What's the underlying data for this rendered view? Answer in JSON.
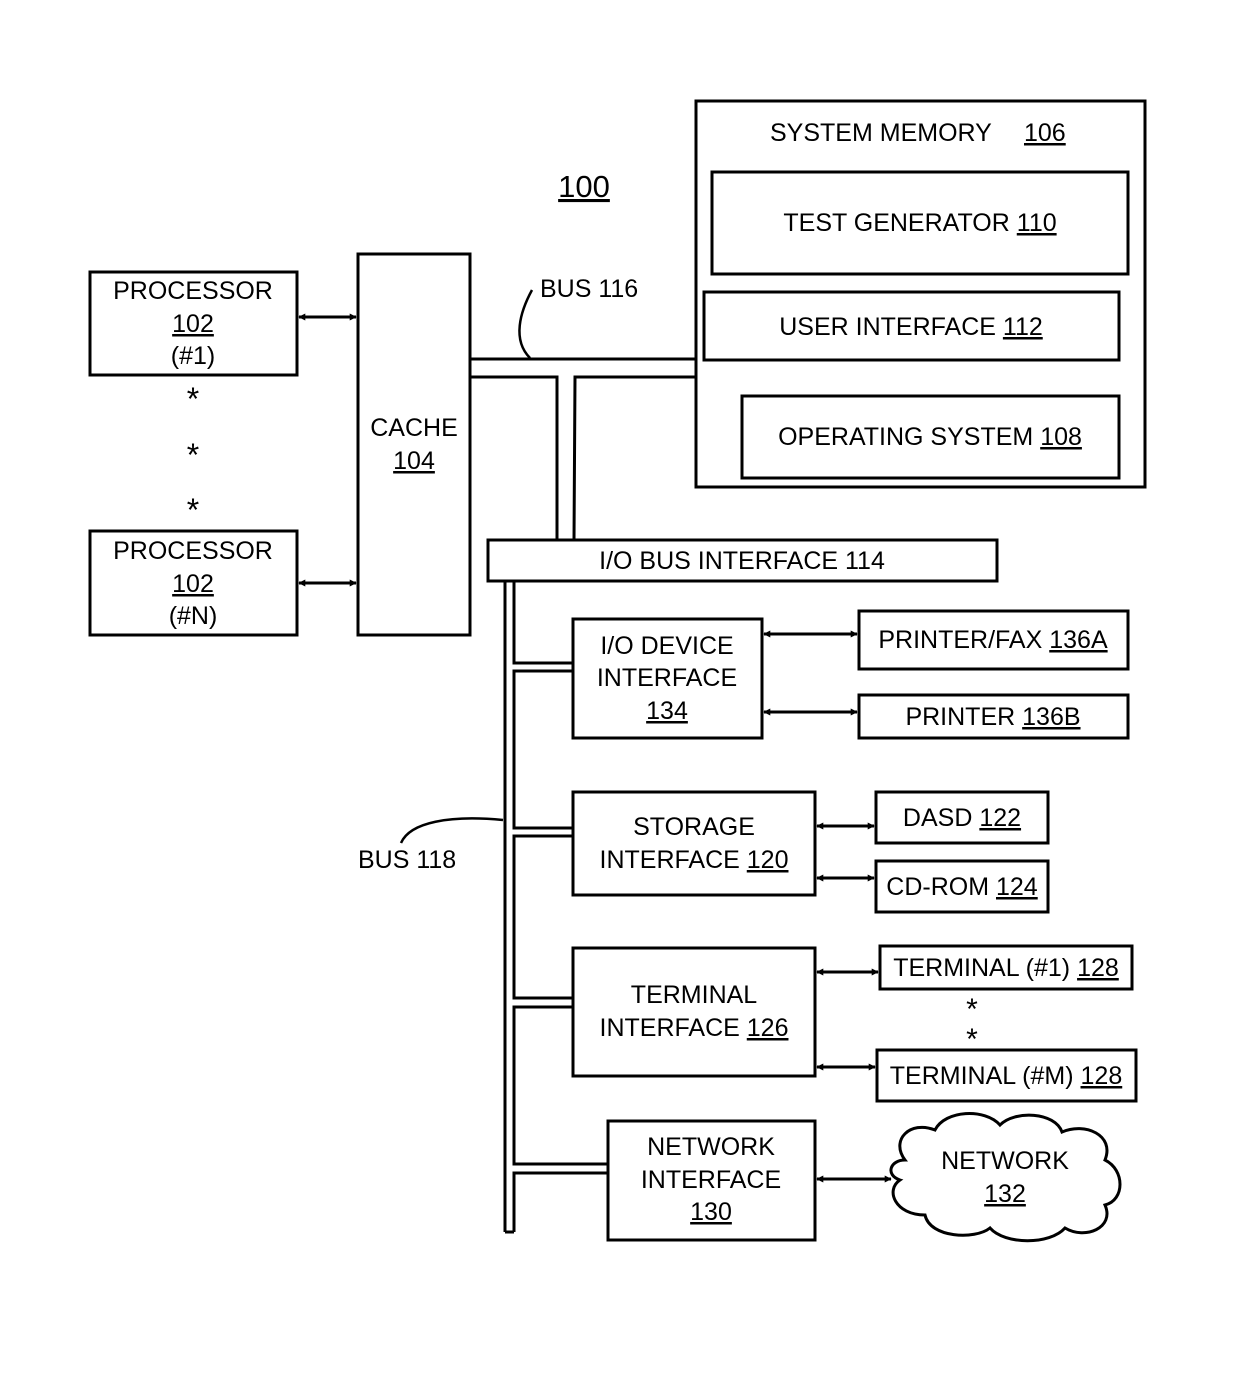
{
  "figure": {
    "ref": "100",
    "colors": {
      "stroke": "#000000",
      "background": "#ffffff"
    }
  },
  "nodes": {
    "processor1": {
      "name": "PROCESSOR",
      "ref": "102",
      "suffix": "(#1)"
    },
    "processorN": {
      "name": "PROCESSOR",
      "ref": "102",
      "suffix": "(#N)"
    },
    "processor_ellipsis": "*",
    "cache": {
      "name": "CACHE",
      "ref": "104"
    },
    "system_memory": {
      "name": "SYSTEM MEMORY",
      "ref": "106"
    },
    "test_generator": {
      "name": "TEST GENERATOR",
      "ref": "110"
    },
    "user_interface": {
      "name": "USER INTERFACE",
      "ref": "112"
    },
    "operating_system": {
      "name": "OPERATING SYSTEM",
      "ref": "108"
    },
    "io_bus_interface": {
      "label": "I/O BUS INTERFACE 114"
    },
    "io_device_interface": {
      "line1": "I/O DEVICE",
      "line2": "INTERFACE",
      "ref": "134"
    },
    "printer_fax": {
      "name": "PRINTER/FAX",
      "ref": "136A"
    },
    "printer": {
      "name": "PRINTER",
      "ref": "136B"
    },
    "storage_interface": {
      "line1": "STORAGE",
      "line2": "INTERFACE",
      "ref": "120"
    },
    "dasd": {
      "name": "DASD",
      "ref": "122"
    },
    "cdrom": {
      "name": "CD-ROM",
      "ref": "124"
    },
    "terminal_interface": {
      "line1": "TERMINAL",
      "line2": "INTERFACE",
      "ref": "126"
    },
    "terminal1": {
      "name": "TERMINAL (#1)",
      "ref": "128"
    },
    "terminalM": {
      "name": "TERMINAL (#M)",
      "ref": "128"
    },
    "terminal_ellipsis": "*",
    "network_interface": {
      "line1": "NETWORK",
      "line2": "INTERFACE",
      "ref": "130"
    },
    "network": {
      "name": "NETWORK",
      "ref": "132"
    }
  },
  "buses": {
    "bus116": "BUS 116",
    "bus118": "BUS 118"
  }
}
